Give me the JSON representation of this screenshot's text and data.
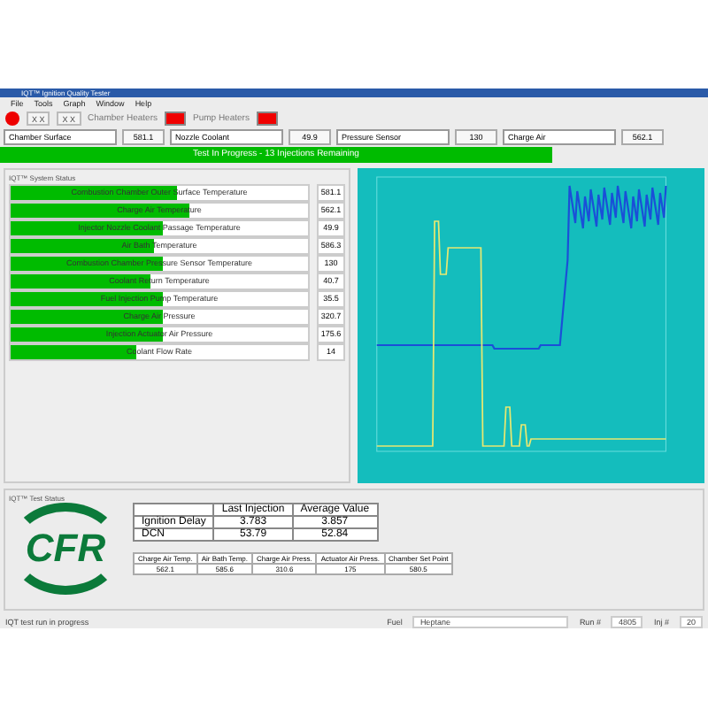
{
  "window": {
    "title": "IQT™ Ignition Quality Tester"
  },
  "menu": [
    "File",
    "Tools",
    "Graph",
    "Window",
    "Help"
  ],
  "toolbar": {
    "tools": [
      "X X",
      "X X"
    ],
    "indicators": [
      {
        "label": "Chamber Heaters",
        "on": true
      },
      {
        "label": "Pump Heaters",
        "on": true
      }
    ]
  },
  "selectors": [
    {
      "option": "Chamber Surface",
      "value": "581.1"
    },
    {
      "option": "Nozzle Coolant",
      "value": "49.9"
    },
    {
      "option": "Pressure Sensor",
      "value": "130"
    },
    {
      "option": "Charge Air",
      "value": "562.1"
    }
  ],
  "banner": "Test In Progress - 13 Injections Remaining",
  "system_status": {
    "title": "IQT™ System Status",
    "sensors": [
      {
        "label": "Combustion Chamber Outer Surface Temperature",
        "level": 0.56,
        "value": "581.1"
      },
      {
        "label": "Charge Air Temperature",
        "level": 0.6,
        "value": "562.1"
      },
      {
        "label": "Injector Nozzle Coolant Passage Temperature",
        "level": 0.51,
        "value": "49.9"
      },
      {
        "label": "Air Bath Temperature",
        "level": 0.48,
        "value": "586.3"
      },
      {
        "label": "Combustion Chamber Pressure Sensor Temperature",
        "level": 0.51,
        "value": "130"
      },
      {
        "label": "Coolant Return Temperature",
        "level": 0.47,
        "value": "40.7"
      },
      {
        "label": "Fuel Injection Pump Temperature",
        "level": 0.51,
        "value": "35.5"
      },
      {
        "label": "Charge Air Pressure",
        "level": 0.51,
        "value": "320.7"
      },
      {
        "label": "Injection Actuator Air Pressure",
        "level": 0.51,
        "value": "175.6"
      },
      {
        "label": "Coolant Flow Rate",
        "level": 0.42,
        "value": "14"
      }
    ]
  },
  "test_status": {
    "title": "IQT™ Test Status",
    "logo": "CFR",
    "results": {
      "columns": [
        "Last Injection",
        "Average Value"
      ],
      "rows": [
        {
          "name": "Ignition Delay",
          "values": [
            "3.783",
            "3.857"
          ]
        },
        {
          "name": "DCN",
          "values": [
            "53.79",
            "52.84"
          ]
        }
      ]
    },
    "conditions": [
      {
        "label": "Charge Air Temp.",
        "value": "562.1"
      },
      {
        "label": "Air Bath Temp.",
        "value": "585.6"
      },
      {
        "label": "Charge Air Press.",
        "value": "310.6"
      },
      {
        "label": "Actuator Air Press.",
        "value": "175"
      },
      {
        "label": "Chamber Set Point",
        "value": "580.5"
      }
    ]
  },
  "status_bar": {
    "message": "IQT test run in progress",
    "fuel_label": "Fuel",
    "fuel": "Heptane",
    "run_label": "Run #",
    "run": "4805",
    "inj_label": "Inj #",
    "inj": "20"
  }
}
